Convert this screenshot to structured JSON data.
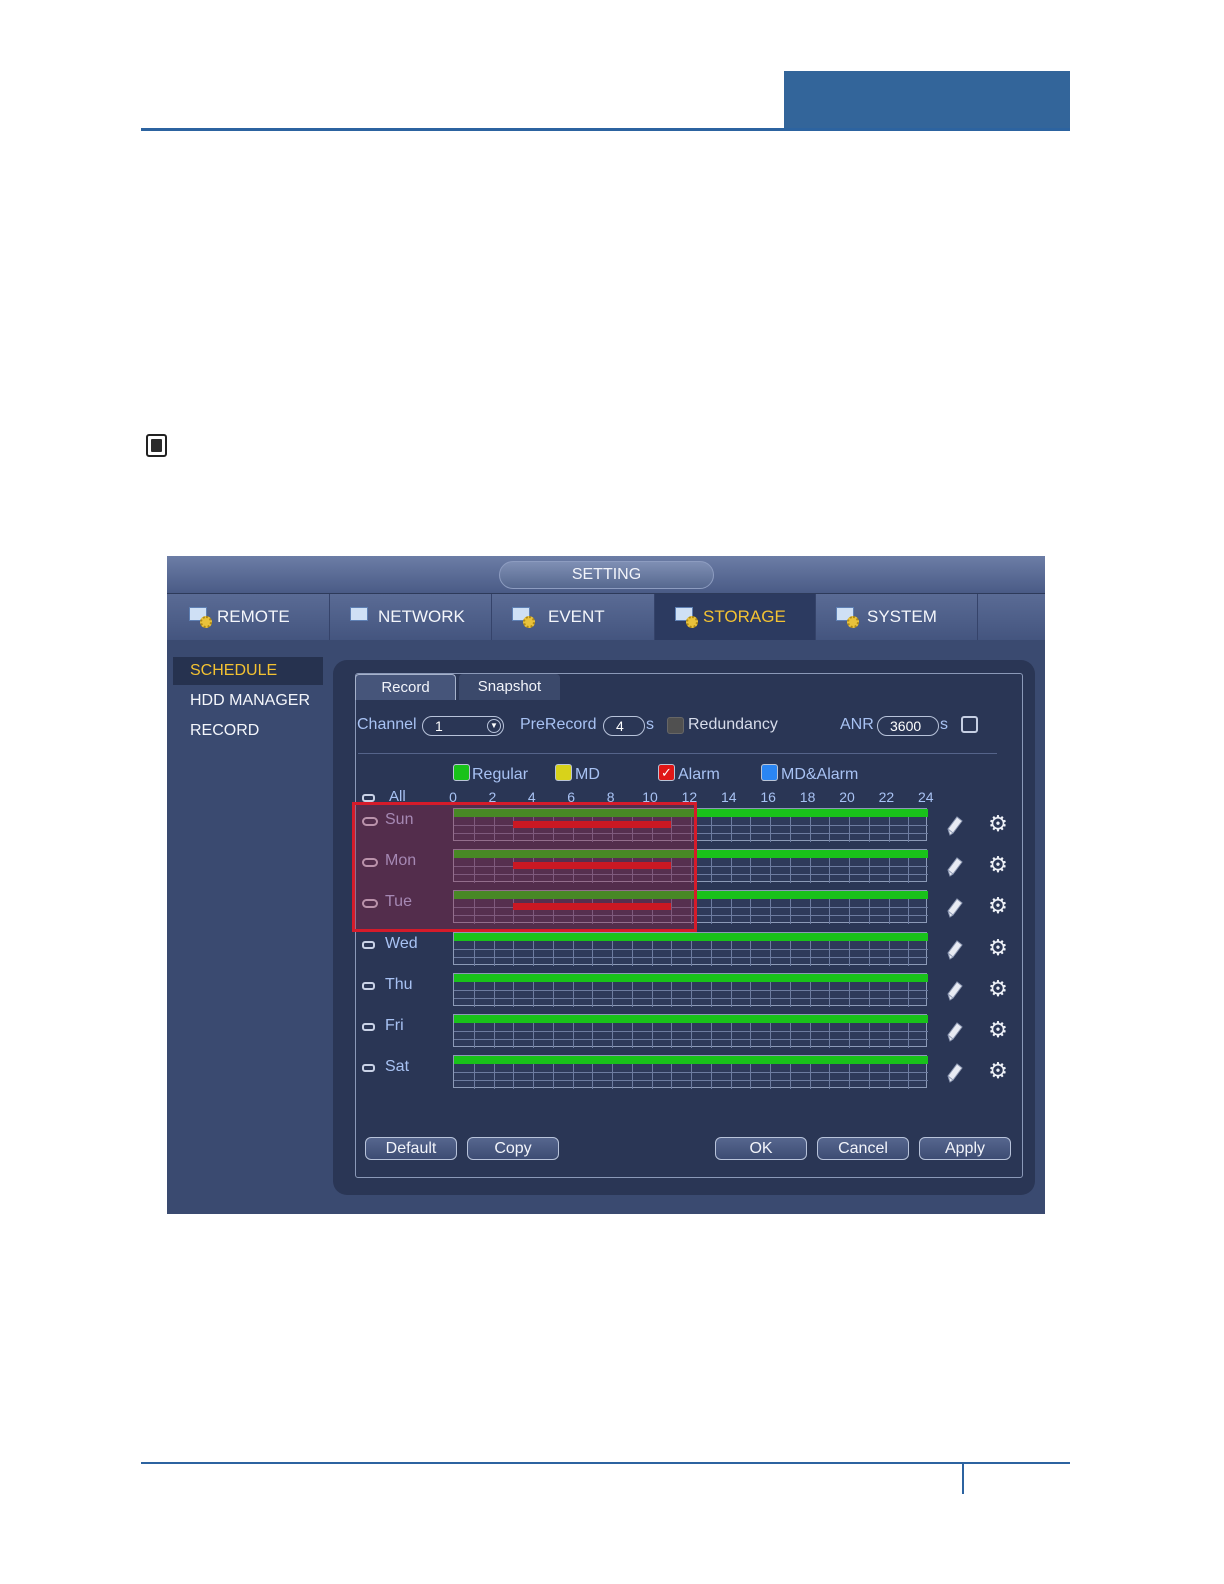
{
  "window": {
    "title": "SETTING"
  },
  "main_tabs": [
    {
      "label": "REMOTE",
      "icon": "remote-gear-icon"
    },
    {
      "label": "NETWORK",
      "icon": "network-icon"
    },
    {
      "label": "EVENT",
      "icon": "event-icon"
    },
    {
      "label": "STORAGE",
      "icon": "storage-icon",
      "active": true
    },
    {
      "label": "SYSTEM",
      "icon": "system-icon"
    }
  ],
  "sidebar": {
    "items": [
      {
        "label": "SCHEDULE",
        "active": true
      },
      {
        "label": "HDD MANAGER"
      },
      {
        "label": "RECORD"
      }
    ]
  },
  "sub_tabs": [
    {
      "label": "Record",
      "active": true
    },
    {
      "label": "Snapshot"
    }
  ],
  "controls": {
    "channel_label": "Channel",
    "channel_value": "1",
    "prerecord_label": "PreRecord",
    "prerecord_value": "4",
    "prerecord_unit": "s",
    "redundancy_label": "Redundancy",
    "anr_label": "ANR",
    "anr_value": "3600",
    "anr_unit": "s"
  },
  "legend": [
    {
      "label": "Regular",
      "color": "#19c21a"
    },
    {
      "label": "MD",
      "color": "#d8d21a"
    },
    {
      "label": "Alarm",
      "color": "#e01616",
      "checked": true
    },
    {
      "label": "MD&Alarm",
      "color": "#2b86f3"
    }
  ],
  "all_label": "All",
  "hours": [
    "0",
    "2",
    "4",
    "6",
    "8",
    "10",
    "12",
    "14",
    "16",
    "18",
    "20",
    "22",
    "24"
  ],
  "days": [
    {
      "label": "Sun",
      "linked": true,
      "regular": [
        0,
        24
      ],
      "alarm": [
        3,
        11
      ]
    },
    {
      "label": "Mon",
      "linked": true,
      "regular": [
        0,
        24
      ],
      "alarm": [
        3,
        11
      ]
    },
    {
      "label": "Tue",
      "linked": true,
      "regular": [
        0,
        24
      ],
      "alarm": [
        3,
        11
      ]
    },
    {
      "label": "Wed",
      "linked": false,
      "regular": [
        0,
        24
      ]
    },
    {
      "label": "Thu",
      "linked": false,
      "regular": [
        0,
        24
      ]
    },
    {
      "label": "Fri",
      "linked": false,
      "regular": [
        0,
        24
      ]
    },
    {
      "label": "Sat",
      "linked": false,
      "regular": [
        0,
        24
      ]
    }
  ],
  "buttons": {
    "default": "Default",
    "copy": "Copy",
    "ok": "OK",
    "cancel": "Cancel",
    "apply": "Apply"
  },
  "colors": {
    "page_rule": "#2c63a0",
    "active_tab_text": "#f3c232",
    "highlight_box": "#d51b2a"
  }
}
